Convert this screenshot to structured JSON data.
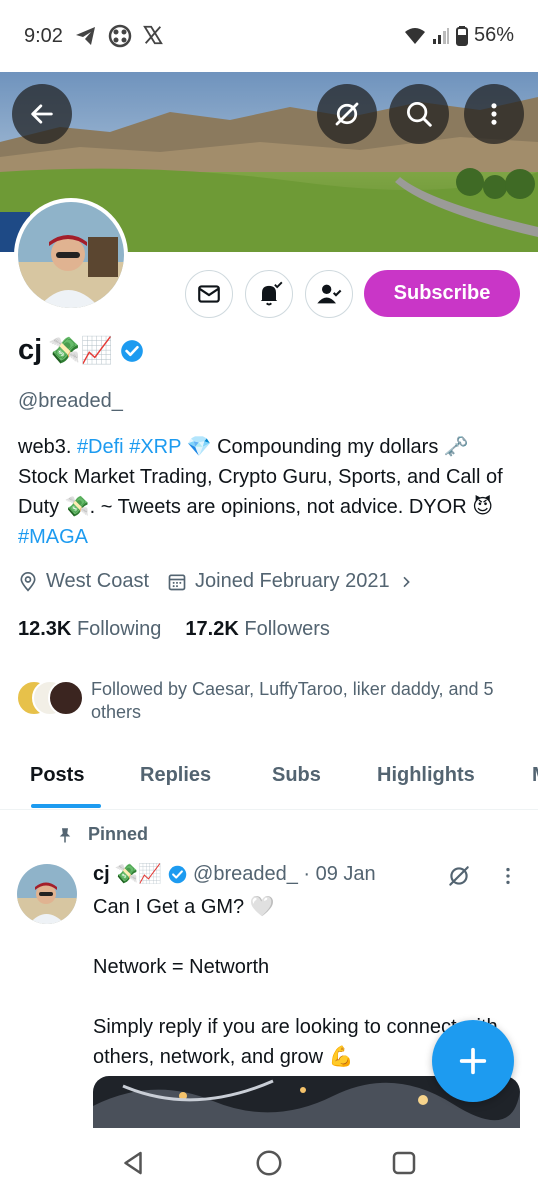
{
  "status_bar": {
    "time": "9:02",
    "battery": "56%",
    "icons_left": [
      "telegram-icon",
      "app-icon",
      "x-icon"
    ],
    "icons_right": [
      "wifi-icon",
      "signal-icon",
      "battery-icon"
    ]
  },
  "profile": {
    "display_name": "cj",
    "name_emojis": "💸📈",
    "handle": "@breaded_",
    "bio": {
      "text1": "web3. ",
      "tag1": "#Defi",
      "space1": " ",
      "tag2": "#XRP",
      "text2": " 💎 Compounding my dollars 🗝️ Stock Market Trading, Crypto Guru, Sports, and Call of Duty 💸. ~ Tweets are opinions, not advice. DYOR 😈 ",
      "tag3": "#MAGA"
    },
    "location": "West Coast",
    "joined": "Joined February 2021",
    "following_count": "12.3K",
    "following_label": "Following",
    "followers_count": "17.2K",
    "followers_label": "Followers",
    "followed_by": "Followed by Caesar, LuffyTaroo, liker daddy, and 5 others",
    "subscribe_label": "Subscribe"
  },
  "tabs": [
    {
      "label": "Posts",
      "active": true
    },
    {
      "label": "Replies",
      "active": false
    },
    {
      "label": "Subs",
      "active": false
    },
    {
      "label": "Highlights",
      "active": false
    },
    {
      "label": "M",
      "active": false
    }
  ],
  "tweet": {
    "pinned_label": "Pinned",
    "name": "cj",
    "name_emojis": "💸📈",
    "handle_date": "@breaded_ · 09 Jan",
    "text": "Can I Get a GM? 🤍\n\nNetwork = Networth\n\nSimply reply if you are looking to connect with others, network, and grow 💪"
  },
  "colors": {
    "accent": "#1d9bf0",
    "subscribe": "#c936c7",
    "secondary_text": "#536471",
    "verified": "#1d9bf0"
  }
}
